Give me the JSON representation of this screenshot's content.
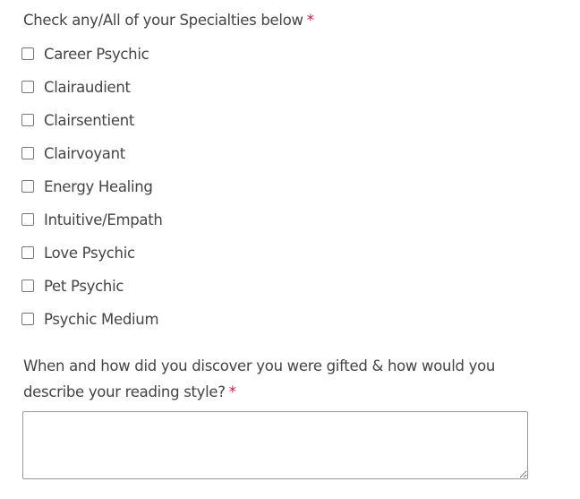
{
  "specialties": {
    "label": "Check any/All of your Specialties below",
    "required_marker": "*",
    "options": [
      {
        "label": "Career Psychic",
        "checked": false
      },
      {
        "label": "Clairaudient",
        "checked": false
      },
      {
        "label": "Clairsentient",
        "checked": false
      },
      {
        "label": "Clairvoyant",
        "checked": false
      },
      {
        "label": "Energy Healing",
        "checked": false
      },
      {
        "label": "Intuitive/Empath",
        "checked": false
      },
      {
        "label": "Love Psychic",
        "checked": false
      },
      {
        "label": "Pet Psychic",
        "checked": false
      },
      {
        "label": "Psychic Medium",
        "checked": false
      }
    ]
  },
  "discovery_question": {
    "label_line1": "When and how did you discover you were gifted & how would you",
    "label_line2": "describe your reading style?",
    "required_marker": "*",
    "value": ""
  },
  "colors": {
    "text": "#444444",
    "required": "#a3284b"
  }
}
